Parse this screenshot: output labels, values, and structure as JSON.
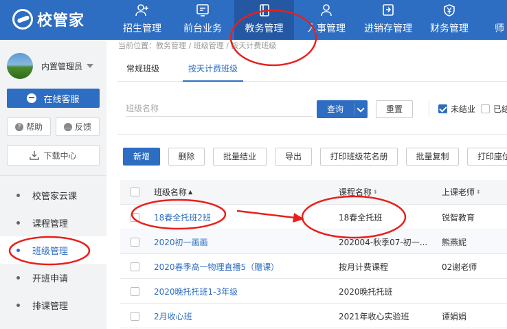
{
  "app": {
    "logo_text": "校管家"
  },
  "nav": [
    {
      "label": "招生管理",
      "icon": "user-plus-icon"
    },
    {
      "label": "前台业务",
      "icon": "monitor-icon"
    },
    {
      "label": "教务管理",
      "icon": "book-icon"
    },
    {
      "label": "人事管理",
      "icon": "person-icon"
    },
    {
      "label": "进销存管理",
      "icon": "inventory-icon"
    },
    {
      "label": "财务管理",
      "icon": "yen-shield-icon"
    },
    {
      "label": "师",
      "icon": ""
    }
  ],
  "nav_active": "教务管理",
  "sidebar": {
    "user_name": "内置管理员",
    "service_label": "在线客服",
    "help_label": "帮助",
    "feedback_label": "反馈",
    "download_label": "下载中心",
    "items": [
      {
        "label": "校管家云课"
      },
      {
        "label": "课程管理"
      },
      {
        "label": "班级管理"
      },
      {
        "label": "开班申请"
      },
      {
        "label": "排课管理"
      }
    ],
    "active_item": "班级管理"
  },
  "breadcrumb": "当前位置：教务管理 / 班级管理 / 按天计费班级",
  "tabs": [
    {
      "label": "常规班级"
    },
    {
      "label": "按天计费班级"
    }
  ],
  "active_tab": "按天计费班级",
  "filters": {
    "class_name_placeholder": "班级名称",
    "query_label": "查询",
    "reset_label": "重置",
    "not_finished_label": "未结业",
    "not_finished_checked": true,
    "finished_label": "已结",
    "finished_checked": false
  },
  "actions": [
    "新增",
    "删除",
    "批量结业",
    "导出",
    "打印班级花名册",
    "批量复制",
    "打印座位"
  ],
  "table": {
    "columns": [
      "班级名称",
      "课程名称",
      "上课老师"
    ],
    "rows": [
      {
        "class_name": "18春全托班2班",
        "course": "18春全托班",
        "teacher": "锐智教育"
      },
      {
        "class_name": "2020初一画画",
        "course": "202004-秋季07-初一...",
        "teacher": "熊燕妮"
      },
      {
        "class_name": "2020春季高一物理直播5（赠课）",
        "course": "按月计费课程",
        "teacher": "02谢老师"
      },
      {
        "class_name": "2020晚托托班1-3年级",
        "course": "2020晚托托班",
        "teacher": ""
      },
      {
        "class_name": "2月收心班",
        "course": "2021年收心实验班",
        "teacher": "谭娟娟"
      }
    ]
  },
  "colors": {
    "primary": "#2d6dc2",
    "annotation": "#e8201c"
  }
}
